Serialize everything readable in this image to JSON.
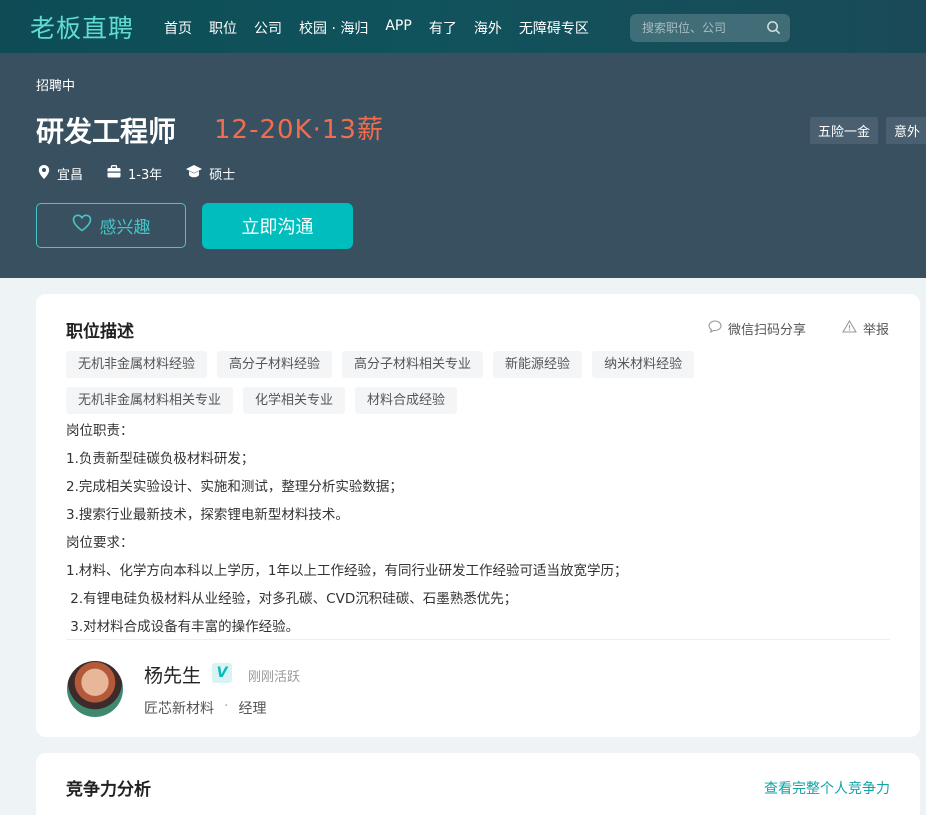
{
  "nav": {
    "logo": "老板直聘",
    "links": [
      "首页",
      "职位",
      "公司",
      "校园 · 海归",
      "APP",
      "有了",
      "海外",
      "无障碍专区"
    ],
    "search_placeholder": "搜索职位、公司"
  },
  "job": {
    "status": "招聘中",
    "title": "研发工程师",
    "salary": "12-20K·13薪",
    "benefits": [
      "五险一金",
      "意外"
    ],
    "location": "宜昌",
    "experience": "1-3年",
    "degree": "硕士",
    "interest_label": "感兴趣",
    "chat_label": "立即沟通"
  },
  "description": {
    "title": "职位描述",
    "share_label": "微信扫码分享",
    "report_label": "举报",
    "tags": [
      "无机非金属材料经验",
      "高分子材料经验",
      "高分子材料相关专业",
      "新能源经验",
      "纳米材料经验",
      "无机非金属材料相关专业",
      "化学相关专业",
      "材料合成经验"
    ],
    "text": "岗位职责：\n1.负责新型硅碳负极材料研发；\n2.完成相关实验设计、实施和测试，整理分析实验数据；\n3.搜索行业最新技术，探索锂电新型材料技术。\n岗位要求：\n1.材料、化学方向本科以上学历，1年以上工作经验，有同行业研发工作经验可适当放宽学历；\n 2.有锂电硅负极材料从业经验，对多孔碳、CVD沉积硅碳、石墨熟悉优先；\n 3.对材料合成设备有丰富的操作经验。"
  },
  "recruiter": {
    "name": "杨先生",
    "verified_mark": "V",
    "activity": "刚刚活跃",
    "company": "匠芯新材料",
    "role": "经理"
  },
  "competitiveness": {
    "title": "竞争力分析",
    "link": "查看完整个人竞争力"
  },
  "colors": {
    "nav_bg": "#0d4c55",
    "logo": "#5fdcd2",
    "hero_bg": "#38505f",
    "salary": "#f26d4f",
    "accent": "#00bebd"
  }
}
